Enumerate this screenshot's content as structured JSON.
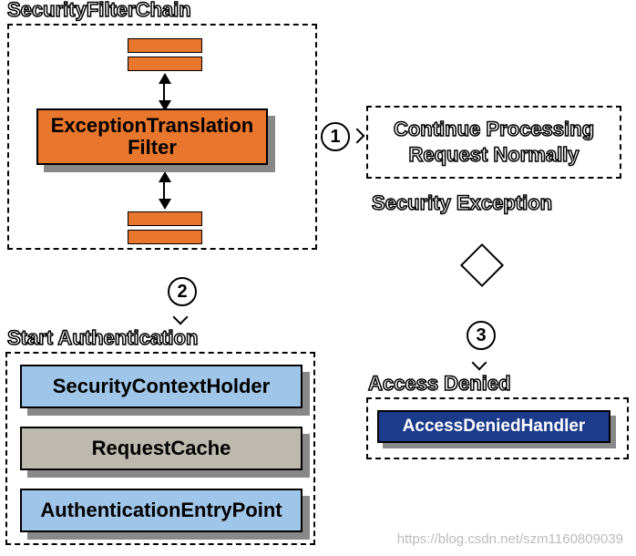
{
  "groups": {
    "security_filter_chain": "SecurityFilterChain",
    "continue_processing": "Continue Processing Request Normally",
    "security_exception": "Security Exception",
    "start_authentication": "Start Authentication",
    "access_denied": "Access Denied"
  },
  "boxes": {
    "exception_translation_filter": "ExceptionTranslation Filter",
    "security_context_holder": "SecurityContextHolder",
    "request_cache": "RequestCache",
    "authentication_entry_point": "AuthenticationEntryPoint",
    "access_denied_handler": "AccessDeniedHandler"
  },
  "steps": {
    "one": "1",
    "two": "2",
    "three": "3"
  },
  "watermark": "https://blog.csdn.net/szm1160809039"
}
